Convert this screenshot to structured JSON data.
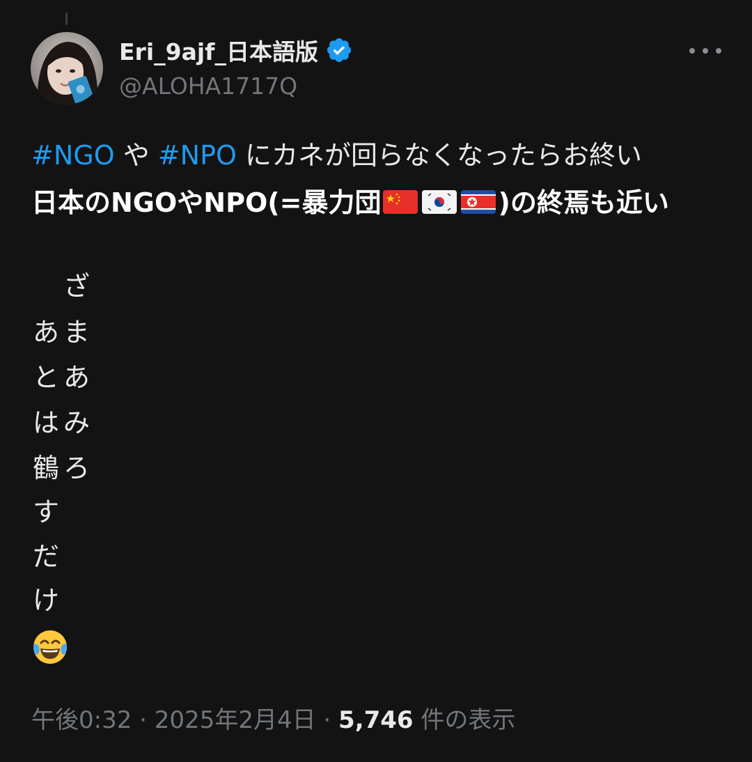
{
  "author": {
    "display_name": "Eri_9ajf_日本語版",
    "handle": "@ALOHA1717Q",
    "verified_color": "#1d9bf0"
  },
  "post": {
    "hashtag_1": "#NGO",
    "between": " や ",
    "hashtag_2": "#NPO",
    "line1_rest": " にカネが回らなくなったらお終い",
    "line2_start": "日本のNGOやNPO(=暴力団",
    "line2_end": ")の終焉も近い",
    "flags": [
      "china-flag",
      "south-korea-flag",
      "north-korea-flag"
    ],
    "vertical_column_right": [
      "ざ",
      "ま",
      "あ",
      "み",
      "ろ"
    ],
    "vertical_column_left": [
      "あ",
      "と",
      "は",
      "鶴",
      "す",
      "だ",
      "け"
    ],
    "emoji": "face-with-tears-of-joy"
  },
  "meta": {
    "time": "午後0:32",
    "sep1": " · ",
    "date": "2025年2月4日",
    "sep2": " · ",
    "views": "5,746",
    "views_label": " 件の表示"
  }
}
